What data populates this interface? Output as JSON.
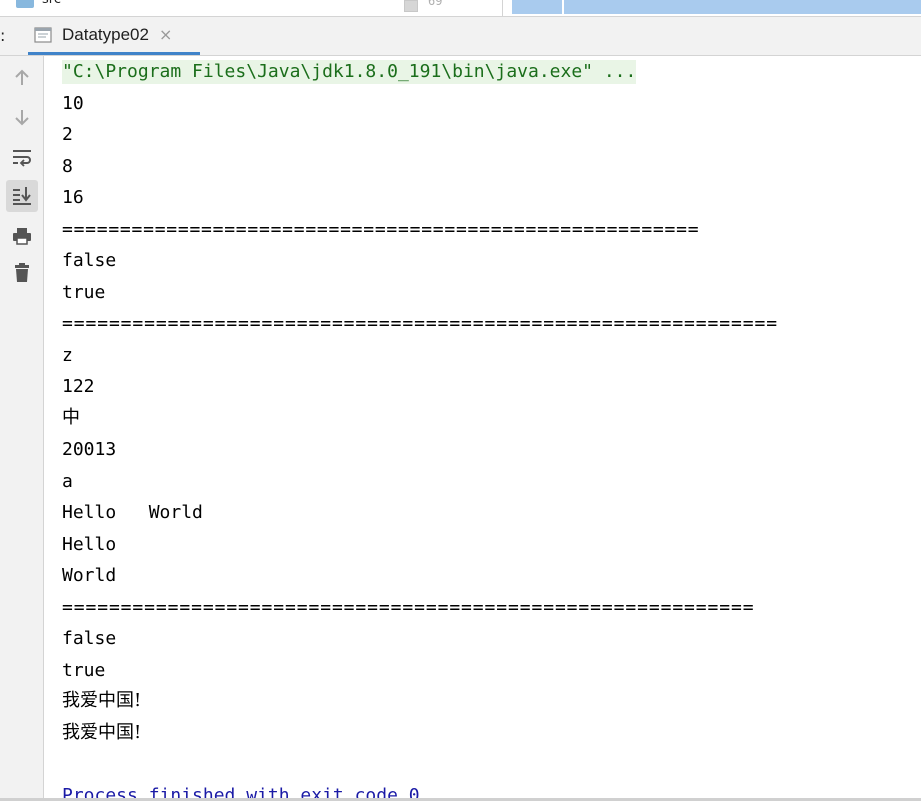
{
  "top_strip": {
    "folder_label": "src",
    "gutter_number": "69"
  },
  "header": {
    "left_fragment": ":",
    "tab": {
      "label": "Datatype02",
      "close_glyph": "×"
    }
  },
  "toolbar": {
    "buttons": [
      {
        "name": "up-arrow-icon",
        "glyph": "↑"
      },
      {
        "name": "down-arrow-icon",
        "glyph": "↓"
      },
      {
        "name": "soft-wrap-icon"
      },
      {
        "name": "scroll-to-end-icon"
      },
      {
        "name": "print-icon"
      },
      {
        "name": "trash-icon"
      }
    ]
  },
  "console": {
    "command": "\"C:\\Program Files\\Java\\jdk1.8.0_191\\bin\\java.exe\" ...",
    "lines": [
      "10",
      "2",
      "8",
      "16",
      "=======================================================",
      "false",
      "true",
      "=============================================================",
      "z",
      "122",
      "中",
      "20013",
      "a",
      "Hello   World",
      "Hello",
      "World",
      "===========================================================",
      "false",
      "true",
      "我爱中国!",
      "我爱中国!"
    ],
    "exit_message": "Process finished with exit code 0"
  },
  "colors": {
    "command_bg": "#e9f5e6",
    "command_fg": "#1b6e1b",
    "exit_fg": "#1a1aa6",
    "tab_underline": "#4083c9"
  }
}
